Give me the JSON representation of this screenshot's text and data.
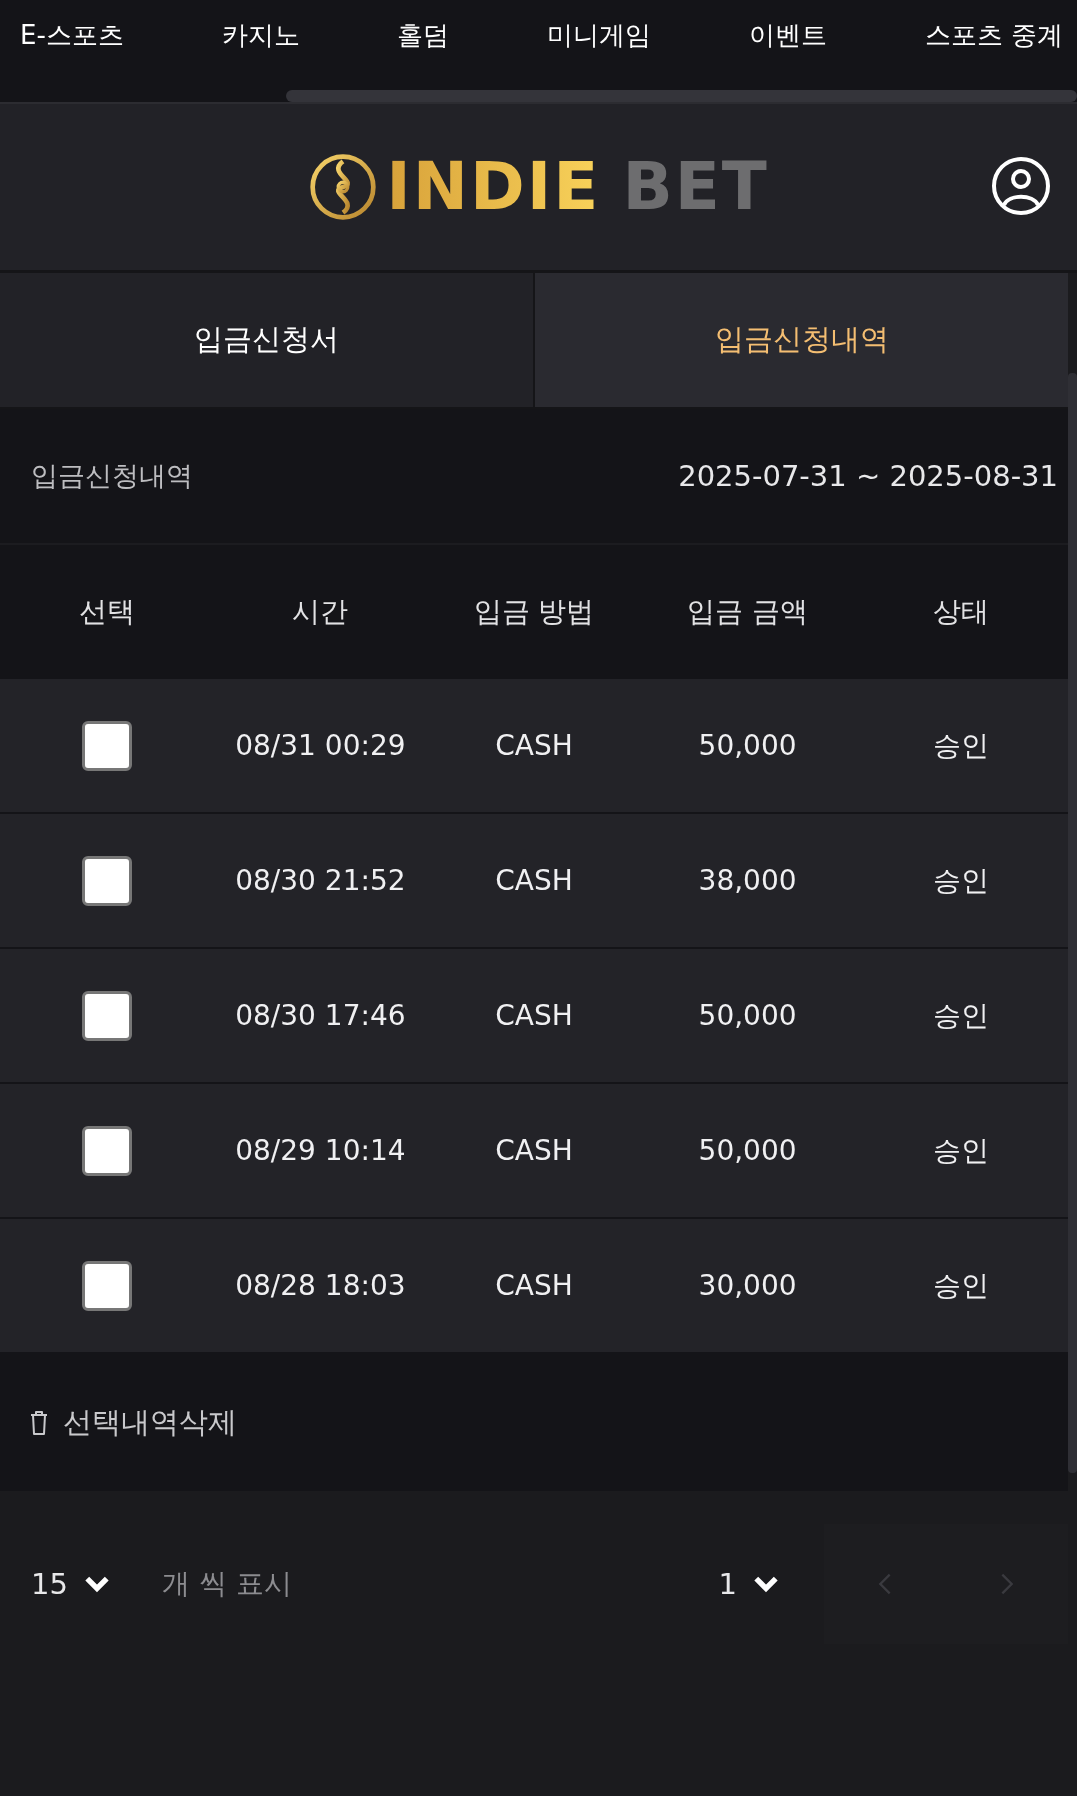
{
  "top_nav": [
    {
      "label": "E-스포츠"
    },
    {
      "label": "카지노"
    },
    {
      "label": "홀덤"
    },
    {
      "label": "미니게임"
    },
    {
      "label": "이벤트"
    },
    {
      "label": "스포츠 중계"
    }
  ],
  "logo": {
    "part_1": "INDIE",
    "part_2": "BET"
  },
  "tabs": [
    {
      "label": "입금신청서",
      "selected": false
    },
    {
      "label": "입금신청내역",
      "selected": true
    }
  ],
  "section": {
    "title": "입금신청내역",
    "date_range": "2025-07-31 ~ 2025-08-31"
  },
  "table": {
    "columns": [
      "선택",
      "시간",
      "입금 방법",
      "입금 금액",
      "상태"
    ],
    "rows": [
      {
        "checked": false,
        "time": "08/31 00:29",
        "method": "CASH",
        "amount": "50,000",
        "status": "승인"
      },
      {
        "checked": false,
        "time": "08/30 21:52",
        "method": "CASH",
        "amount": "38,000",
        "status": "승인"
      },
      {
        "checked": false,
        "time": "08/30 17:46",
        "method": "CASH",
        "amount": "50,000",
        "status": "승인"
      },
      {
        "checked": false,
        "time": "08/29 10:14",
        "method": "CASH",
        "amount": "50,000",
        "status": "승인"
      },
      {
        "checked": false,
        "time": "08/28 18:03",
        "method": "CASH",
        "amount": "30,000",
        "status": "승인"
      }
    ]
  },
  "delete_button": {
    "label": "선택내역삭제"
  },
  "pagination": {
    "page_size": "15",
    "page_size_label": "개 씩 표시",
    "page": "1",
    "prev_disabled": true,
    "next_disabled": true
  }
}
